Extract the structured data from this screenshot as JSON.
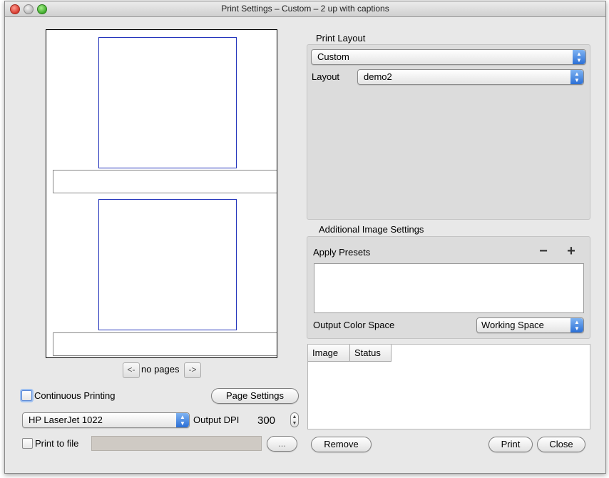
{
  "window": {
    "title": "Print Settings – Custom – 2 up with captions"
  },
  "preview": {
    "nav_prev": "<-",
    "nav_status": "no pages",
    "nav_next": "->"
  },
  "left": {
    "continuous_printing_label": "Continuous Printing",
    "page_settings_label": "Page Settings",
    "printer_value": "HP LaserJet 1022",
    "output_dpi_label": "Output DPI",
    "output_dpi_value": "300",
    "print_to_file_label": "Print to file",
    "print_to_file_path": "",
    "browse_label": "..."
  },
  "print_layout": {
    "section_title": "Print Layout",
    "preset_value": "Custom",
    "layout_label": "Layout",
    "layout_value": "demo2"
  },
  "additional_image_settings": {
    "section_title": "Additional Image Settings",
    "apply_presets_label": "Apply Presets",
    "remove_preset_icon": "minus-icon",
    "add_preset_icon": "plus-icon",
    "output_color_space_label": "Output Color Space",
    "output_color_space_value": "Working Space"
  },
  "queue_table": {
    "columns": [
      "Image",
      "Status"
    ],
    "rows": []
  },
  "bottom_buttons": {
    "remove_label": "Remove",
    "print_label": "Print",
    "close_label": "Close"
  },
  "colors": {
    "accent_blue": "#2b6fd6",
    "image_frame_blue": "#2233bb",
    "close_red": "#d63b2f",
    "zoom_green": "#3faa2b"
  }
}
